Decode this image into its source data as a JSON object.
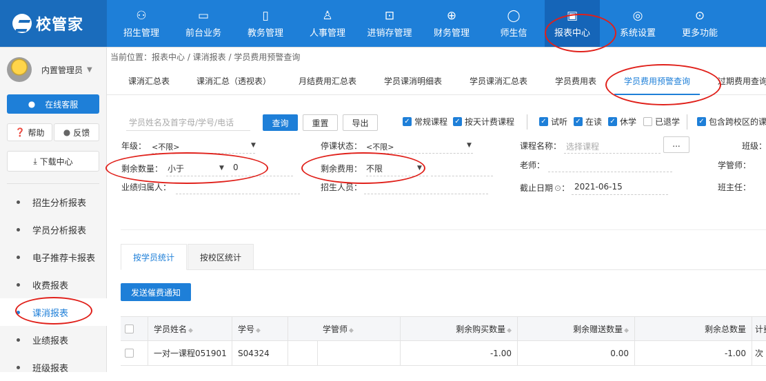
{
  "app": {
    "logo_text": "校管家"
  },
  "nav": [
    {
      "label": "招生管理",
      "icon": "user-add-icon",
      "glyph": "⚇"
    },
    {
      "label": "前台业务",
      "icon": "monitor-icon",
      "glyph": "▭"
    },
    {
      "label": "教务管理",
      "icon": "book-icon",
      "glyph": "▯"
    },
    {
      "label": "人事管理",
      "icon": "person-icon",
      "glyph": "♙"
    },
    {
      "label": "进销存管理",
      "icon": "box-arrow-icon",
      "glyph": "⊡"
    },
    {
      "label": "财务管理",
      "icon": "wallet-icon",
      "glyph": "⊕"
    },
    {
      "label": "师生信",
      "icon": "chat-icon",
      "glyph": "◯"
    },
    {
      "label": "报表中心",
      "icon": "report-icon",
      "glyph": "▣"
    },
    {
      "label": "系统设置",
      "icon": "settings-icon",
      "glyph": "◎"
    },
    {
      "label": "更多功能",
      "icon": "more-icon",
      "glyph": "⊙"
    }
  ],
  "sidebar": {
    "user_name": "内置管理员",
    "online_service": "在线客服",
    "help": "帮助",
    "feedback": "反馈",
    "download_center": "下载中心",
    "menu": [
      "招生分析报表",
      "学员分析报表",
      "电子推荐卡报表",
      "收费报表",
      "课消报表",
      "业绩报表",
      "班级报表"
    ]
  },
  "breadcrumb": "当前位置：报表中心 / 课消报表 / 学员费用预警查询",
  "tabs": [
    "课消汇总表",
    "课消汇总（透视表）",
    "月结费用汇总表",
    "学员课消明细表",
    "学员课消汇总表",
    "学员费用表",
    "学员费用预警查询",
    "过期费用查询"
  ],
  "search": {
    "placeholder": "学员姓名及首字母/学号/电话",
    "query": "查询",
    "reset": "重置",
    "export": "导出"
  },
  "checks": [
    {
      "label": "常规课程",
      "checked": true
    },
    {
      "label": "按天计费课程",
      "checked": true
    },
    {
      "label": "试听",
      "checked": true
    },
    {
      "label": "在读",
      "checked": true
    },
    {
      "label": "休学",
      "checked": true
    },
    {
      "label": "已退学",
      "checked": false
    },
    {
      "label": "包含跨校区的课",
      "checked": true
    }
  ],
  "filters": {
    "grade_label": "年级：",
    "grade_value": "<不限>",
    "suspend_label": "停课状态：",
    "suspend_value": "<不限>",
    "course_label": "课程名称：",
    "course_placeholder": "选择课程",
    "course_btn": "...",
    "class_label": "班级：",
    "remain_qty_label": "剩余数量：",
    "remain_qty_op": "小于",
    "remain_qty_value": "0",
    "remain_fee_label": "剩余费用：",
    "remain_fee_value": "不限",
    "teacher_label": "老师：",
    "manager_label": "学管师：",
    "perf_label": "业绩归属人：",
    "recruiter_label": "招生人员：",
    "deadline_label": "截止日期",
    "deadline_value": "2021-06-15",
    "head_teacher_label": "班主任："
  },
  "stat_tabs": [
    "按学员统计",
    "按校区统计"
  ],
  "notify_button": "发送催费通知",
  "table": {
    "columns": [
      "学员姓名",
      "学号",
      "学管师",
      "剩余购买数量",
      "剩余赠送数量",
      "剩余总数量",
      "计费"
    ],
    "rows": [
      {
        "name": "一对一课程051901",
        "id": "S04324",
        "manager": "",
        "buy": "-1.00",
        "gift": "0.00",
        "total": "-1.00",
        "unit": "次"
      }
    ]
  },
  "annotation_color": "#e0201a",
  "accent_color": "#1e7fd8"
}
